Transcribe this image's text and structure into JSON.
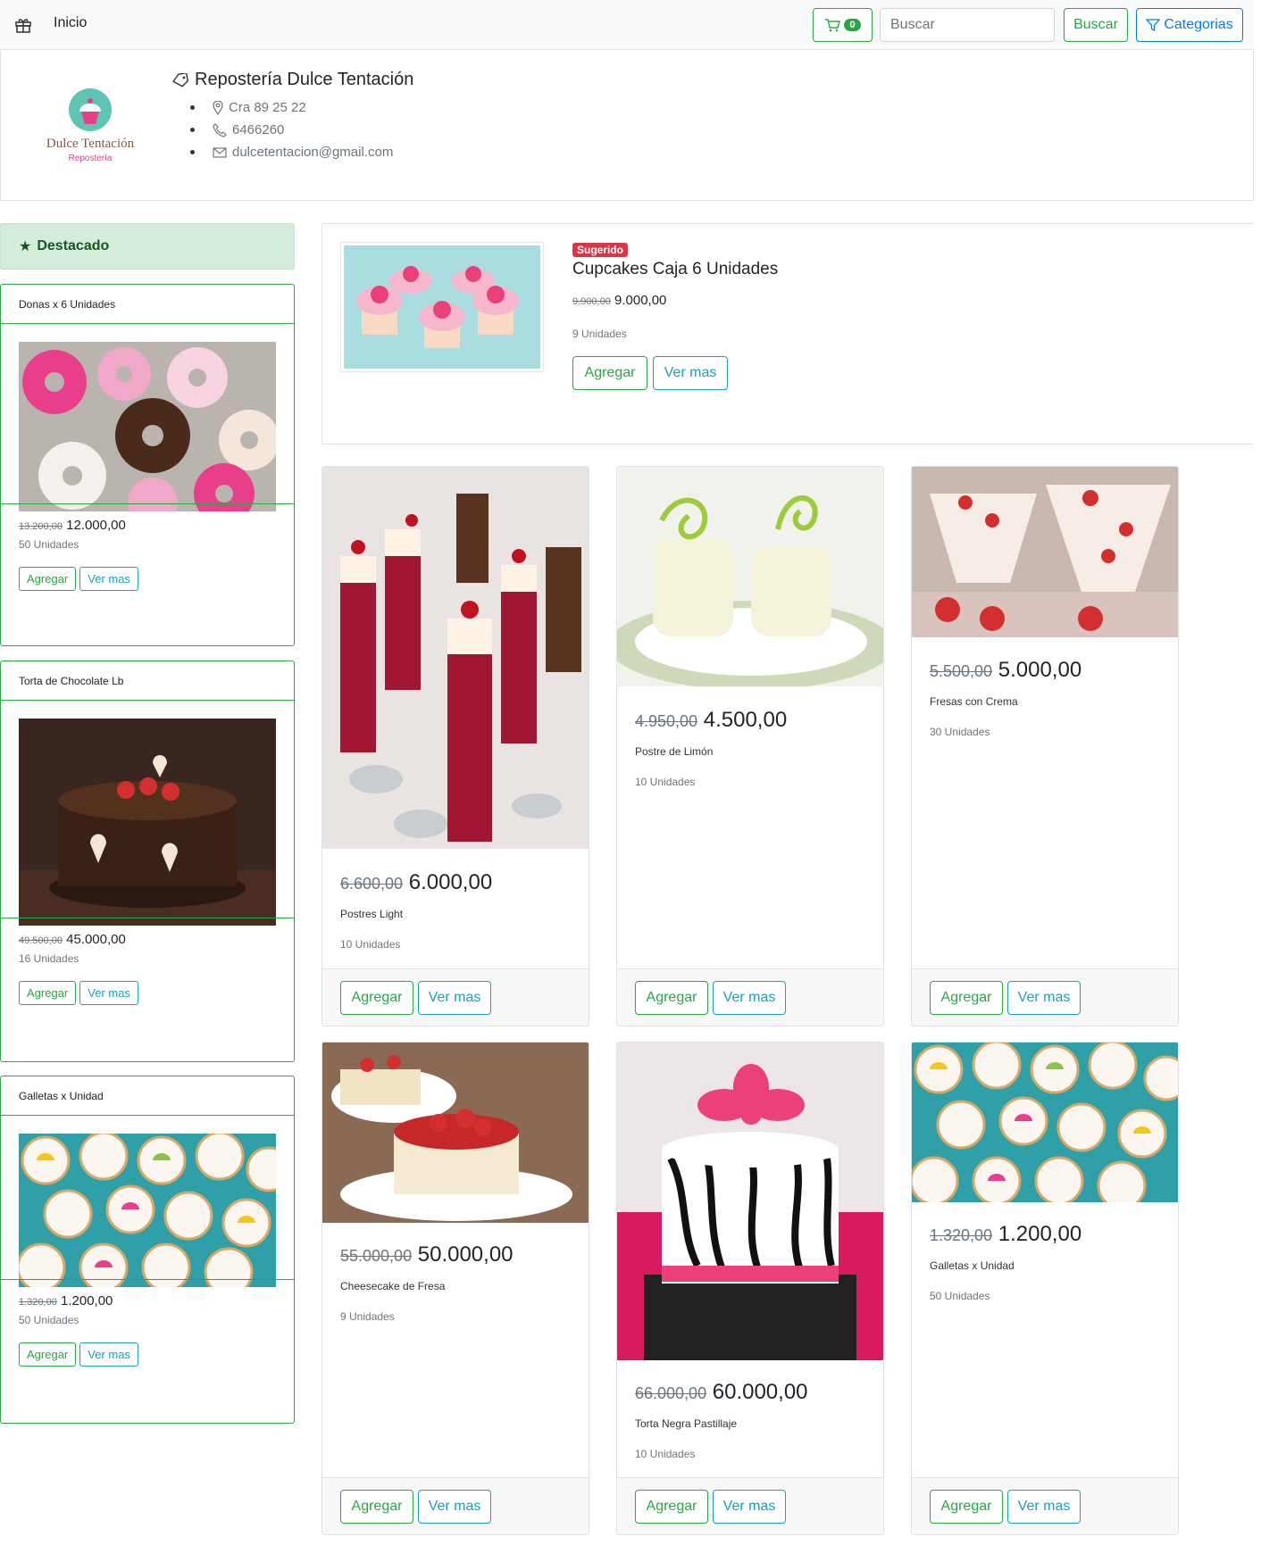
{
  "nav": {
    "home_label": "Inicio",
    "cart_count": "0",
    "search_placeholder": "Buscar",
    "search_button": "Buscar",
    "categories_button": "Categorias"
  },
  "store": {
    "name": "Repostería Dulce Tentación",
    "logo_title": "Dulce Tentación",
    "logo_subtitle": "Repostería",
    "address": "Cra 89 25 22",
    "phone": "6466260",
    "email": "dulcetentacion@gmail.com"
  },
  "featured": {
    "heading": "Destacado",
    "items": [
      {
        "title": "Donas x 6 Unidades",
        "old_price": "13.200,00",
        "price": "12.000,00",
        "units": "50 Unidades",
        "add": "Agregar",
        "more": "Ver mas"
      },
      {
        "title": "Torta de Chocolate Lb",
        "old_price": "49.500,00",
        "price": "45.000,00",
        "units": "16 Unidades",
        "add": "Agregar",
        "more": "Ver mas"
      },
      {
        "title": "Galletas x Unidad",
        "old_price": "1.320,00",
        "price": "1.200,00",
        "units": "50 Unidades",
        "add": "Agregar",
        "more": "Ver mas"
      }
    ]
  },
  "suggested": {
    "badge": "Sugerido",
    "name": "Cupcakes Caja 6 Unidades",
    "old_price": "9.900,00",
    "price": "9.000,00",
    "units": "9 Unidades",
    "add": "Agregar",
    "more": "Ver mas"
  },
  "products": [
    {
      "name": "Postres Light",
      "old_price": "6.600,00",
      "price": "6.000,00",
      "units": "10 Unidades",
      "add": "Agregar",
      "more": "Ver mas"
    },
    {
      "name": "Postre de Limón",
      "old_price": "4.950,00",
      "price": "4.500,00",
      "units": "10 Unidades",
      "add": "Agregar",
      "more": "Ver mas"
    },
    {
      "name": "Fresas con Crema",
      "old_price": "5.500,00",
      "price": "5.000,00",
      "units": "30 Unidades",
      "add": "Agregar",
      "more": "Ver mas"
    },
    {
      "name": "Cheesecake de Fresa",
      "old_price": "55.000,00",
      "price": "50.000,00",
      "units": "9 Unidades",
      "add": "Agregar",
      "more": "Ver mas"
    },
    {
      "name": "Torta Negra Pastillaje",
      "old_price": "66.000,00",
      "price": "60.000,00",
      "units": "10 Unidades",
      "add": "Agregar",
      "more": "Ver mas"
    },
    {
      "name": "Galletas x Unidad",
      "old_price": "1.320,00",
      "price": "1.200,00",
      "units": "50 Unidades",
      "add": "Agregar",
      "more": "Ver mas"
    }
  ]
}
